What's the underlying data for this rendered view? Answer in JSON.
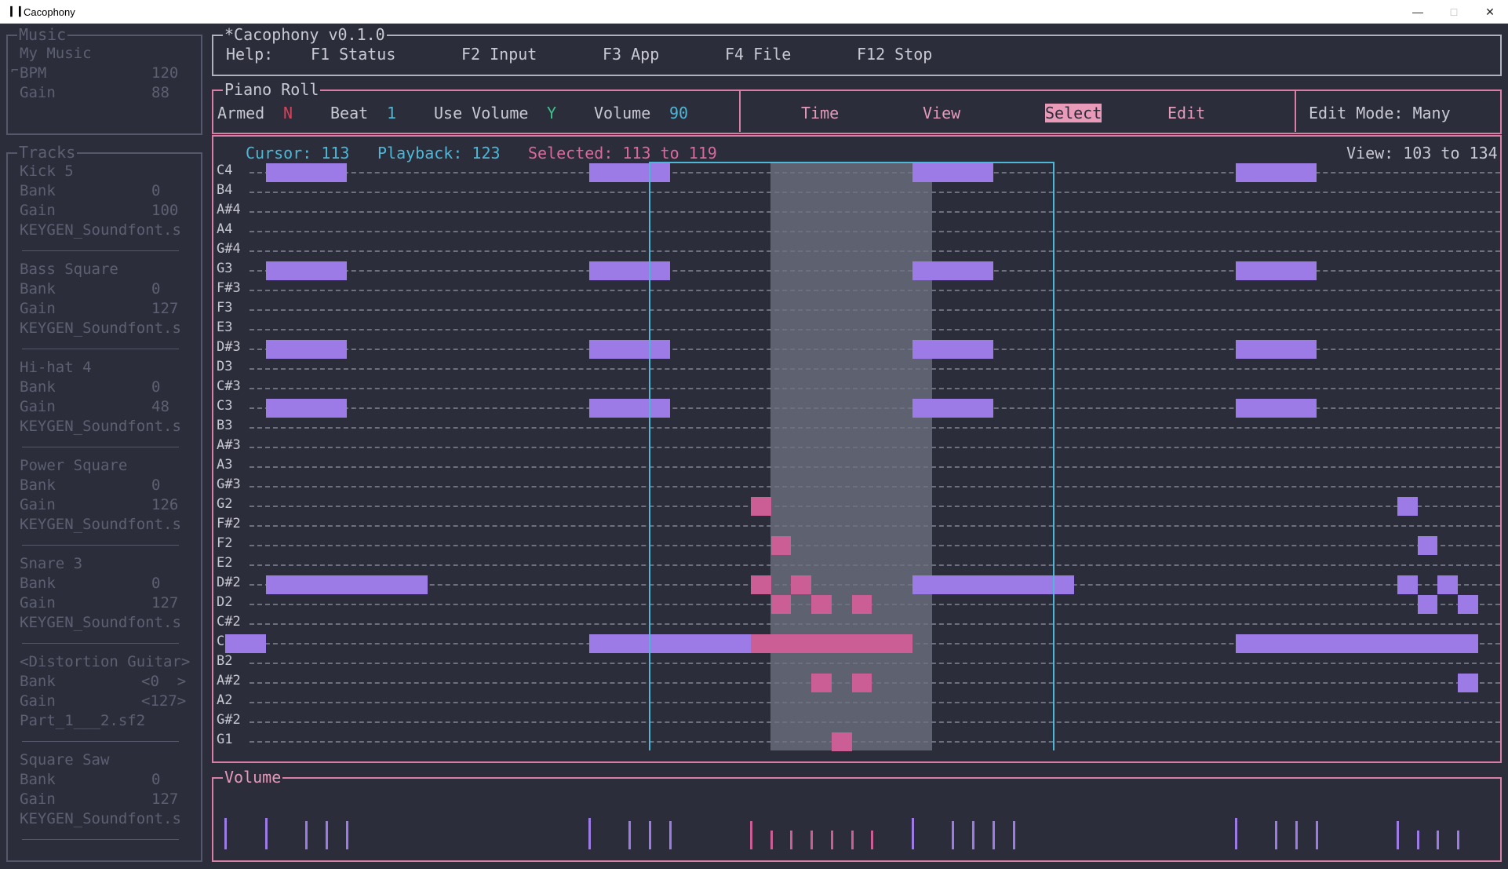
{
  "window": {
    "icon": "bars-icon",
    "title": "Cacophony",
    "minimize": "—",
    "maximize": "□",
    "close": "✕"
  },
  "header": {
    "title": "*Cacophony v0.1.0",
    "help_label": "Help:",
    "keys": [
      "F1 Status",
      "F2 Input",
      "F3 App",
      "F4 File",
      "F12 Stop"
    ]
  },
  "sidebar": {
    "music": {
      "title": "Music",
      "name": "My Music",
      "bpm_label": "BPM",
      "bpm": "120",
      "gain_label": "Gain",
      "gain": "88"
    },
    "tracks_title": "Tracks",
    "tracks": [
      {
        "name": "Kick 5",
        "bank_label": "Bank",
        "bank": "0",
        "gain_label": "Gain",
        "gain": "100",
        "soundfont": "KEYGEN_Soundfont.s"
      },
      {
        "name": "Bass Square",
        "bank_label": "Bank",
        "bank": "0",
        "gain_label": "Gain",
        "gain": "127",
        "soundfont": "KEYGEN_Soundfont.s"
      },
      {
        "name": "Hi-hat 4",
        "bank_label": "Bank",
        "bank": "0",
        "gain_label": "Gain",
        "gain": "48",
        "soundfont": "KEYGEN_Soundfont.s"
      },
      {
        "name": "Power Square",
        "bank_label": "Bank",
        "bank": "0",
        "gain_label": "Gain",
        "gain": "126",
        "soundfont": "KEYGEN_Soundfont.s"
      },
      {
        "name": "Snare 3",
        "bank_label": "Bank",
        "bank": "0",
        "gain_label": "Gain",
        "gain": "127",
        "soundfont": "KEYGEN_Soundfont.s"
      },
      {
        "name": "<Distortion Guitar>",
        "bank_label": "Bank",
        "bank": "<0  >",
        "gain_label": "Gain",
        "gain": "<127>",
        "soundfont": "Part_1___2.sf2"
      },
      {
        "name": "Square Saw",
        "bank_label": "Bank",
        "bank": "0",
        "gain_label": "Gain",
        "gain": "127",
        "soundfont": "KEYGEN_Soundfont.s"
      }
    ]
  },
  "piano_roll": {
    "title": "Piano Roll",
    "armed_label": "Armed",
    "armed": "N",
    "beat_label": "Beat",
    "beat": "1",
    "use_volume_label": "Use Volume",
    "use_volume": "Y",
    "volume_label": "Volume",
    "volume": "90",
    "modes": [
      "Time",
      "View",
      "Select",
      "Edit"
    ],
    "active_mode": "Select",
    "edit_mode": "Edit Mode: Many",
    "cursor": "Cursor: 113",
    "playback": "Playback: 123",
    "selected": "Selected: 113 to 119",
    "view": "View: 103 to 134",
    "notes_labels": [
      "C4",
      "B4",
      "A#4",
      "A4",
      "G#4",
      "G3",
      "F#3",
      "F3",
      "E3",
      "D#3",
      "D3",
      "C#3",
      "C3",
      "B3",
      "A#3",
      "A3",
      "G#3",
      "G2",
      "F#2",
      "F2",
      "E2",
      "D#2",
      "D2",
      "C#2",
      "C2",
      "B2",
      "A#2",
      "A2",
      "G#2",
      "G1"
    ]
  },
  "volume_panel": {
    "title": "Volume"
  },
  "colors": {
    "background": "#2b2d3a",
    "note": "#9c7be6",
    "selected_note": "#cc5e96",
    "selection": "#5d6170",
    "cursor_line": "#4fb7d6",
    "accent_pink": "#d97fa6",
    "accent_blue": "#4fb7d6"
  }
}
